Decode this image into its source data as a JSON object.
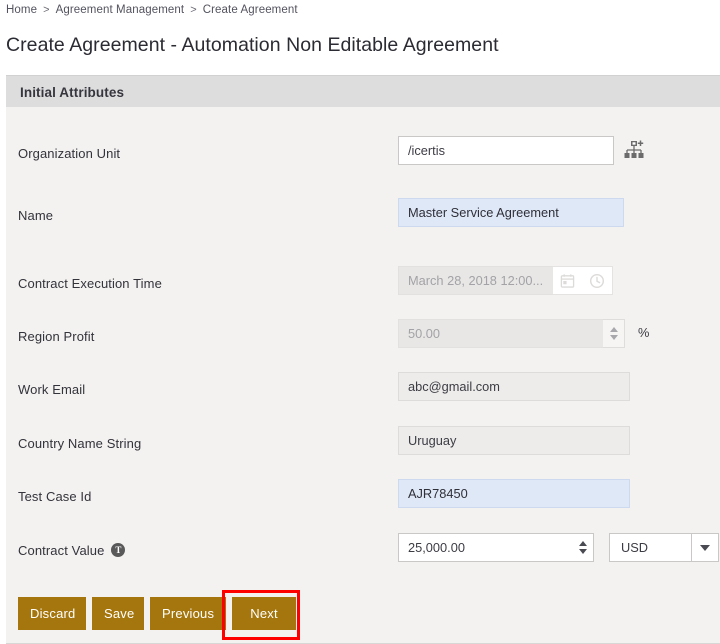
{
  "breadcrumb": {
    "items": [
      "Home",
      "Agreement Management",
      "Create Agreement"
    ],
    "separator": ">"
  },
  "page_title": "Create Agreement - Automation Non Editable Agreement",
  "section": {
    "title": "Initial Attributes"
  },
  "fields": {
    "organization_unit": {
      "label": "Organization Unit",
      "value": "/icertis",
      "icon": "org-chart-add-icon",
      "state": "white"
    },
    "name": {
      "label": "Name",
      "value": "Master Service Agreement",
      "state": "blue"
    },
    "contract_execution_time": {
      "label": "Contract Execution Time",
      "value": "March 28, 2018 12:00...",
      "state": "disabled",
      "calendar_icon": "calendar-icon",
      "clock_icon": "clock-icon"
    },
    "region_profit": {
      "label": "Region Profit",
      "value": "50.00",
      "suffix": "%",
      "state": "disabled"
    },
    "work_email": {
      "label": "Work Email",
      "value": "abc@gmail.com",
      "state": "grey"
    },
    "country_name_string": {
      "label": "Country Name String",
      "value": "Uruguay",
      "state": "grey"
    },
    "test_case_id": {
      "label": "Test Case Id",
      "value": "AJR78450",
      "state": "blue"
    },
    "contract_value": {
      "label": "Contract Value",
      "tooltip_glyph": "T",
      "value": "25,000.00",
      "currency": "USD",
      "state": "white"
    }
  },
  "footer": {
    "discard_label": "Discard",
    "save_label": "Save",
    "previous_label": "Previous",
    "next_label": "Next"
  },
  "annotation": {
    "highlight_color": "#ff0000",
    "target": "Next"
  },
  "colors": {
    "button_gold": "#a5760d",
    "section_header_bg": "#dedddd",
    "form_bg": "#f3f2f0",
    "field_blue": "#dfe8f7"
  }
}
